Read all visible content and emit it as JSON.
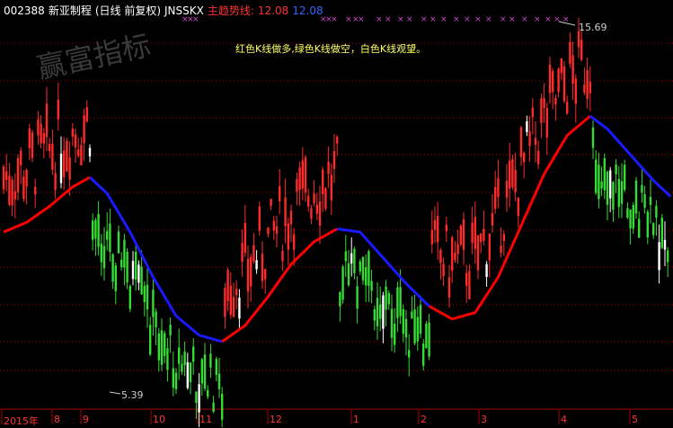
{
  "header": {
    "code": "002388",
    "name": "新亚制程",
    "period": "(日线 前复权)",
    "indicator_name": "JNSSKX",
    "trend_label": "主趋势线:",
    "trend_value_red": "12.08",
    "trend_value_blue": "12.08"
  },
  "watermark": "赢富指标",
  "note": "红色K线做多,绿色K线做空，白色K线观望。",
  "high_label": "15.69",
  "low_label": "5.39",
  "x_axis": {
    "labels": [
      "2015年",
      "8",
      "9",
      "10",
      "11",
      "12",
      "1",
      "2",
      "3",
      "4",
      "5"
    ]
  },
  "colors": {
    "up": "#ff2a2a",
    "down": "#33dd33",
    "neutral": "#ffffff",
    "trend_up": "#ff0000",
    "trend_down": "#1a1aff",
    "grid": "#aa0000",
    "header_code": "#ffffff",
    "header_trend": "#ff3333",
    "header_blue": "#3366ff",
    "marker": "#cc44cc"
  },
  "chart_data": {
    "type": "candlestick",
    "ylim": [
      4.5,
      16.5
    ],
    "trend_line": [
      [
        0,
        9.8
      ],
      [
        8,
        10.1
      ],
      [
        16,
        10.6
      ],
      [
        24,
        11.2
      ],
      [
        30,
        11.5
      ],
      [
        36,
        11.0
      ],
      [
        44,
        9.8
      ],
      [
        52,
        8.4
      ],
      [
        60,
        7.2
      ],
      [
        68,
        6.6
      ],
      [
        76,
        6.4
      ],
      [
        84,
        6.9
      ],
      [
        92,
        7.8
      ],
      [
        100,
        8.8
      ],
      [
        108,
        9.5
      ],
      [
        116,
        9.9
      ],
      [
        124,
        9.8
      ],
      [
        132,
        9.0
      ],
      [
        140,
        8.2
      ],
      [
        148,
        7.5
      ],
      [
        156,
        7.1
      ],
      [
        164,
        7.3
      ],
      [
        172,
        8.4
      ],
      [
        180,
        10.0
      ],
      [
        188,
        11.6
      ],
      [
        196,
        12.8
      ],
      [
        204,
        13.4
      ],
      [
        210,
        13.0
      ],
      [
        218,
        12.2
      ],
      [
        226,
        11.4
      ],
      [
        232,
        10.9
      ]
    ],
    "trend_split_index": [
      [
        0,
        4,
        "up"
      ],
      [
        4,
        10,
        "down"
      ],
      [
        10,
        15,
        "up"
      ],
      [
        15,
        19,
        "down"
      ],
      [
        19,
        26,
        "up"
      ],
      [
        26,
        30,
        "down"
      ]
    ]
  }
}
